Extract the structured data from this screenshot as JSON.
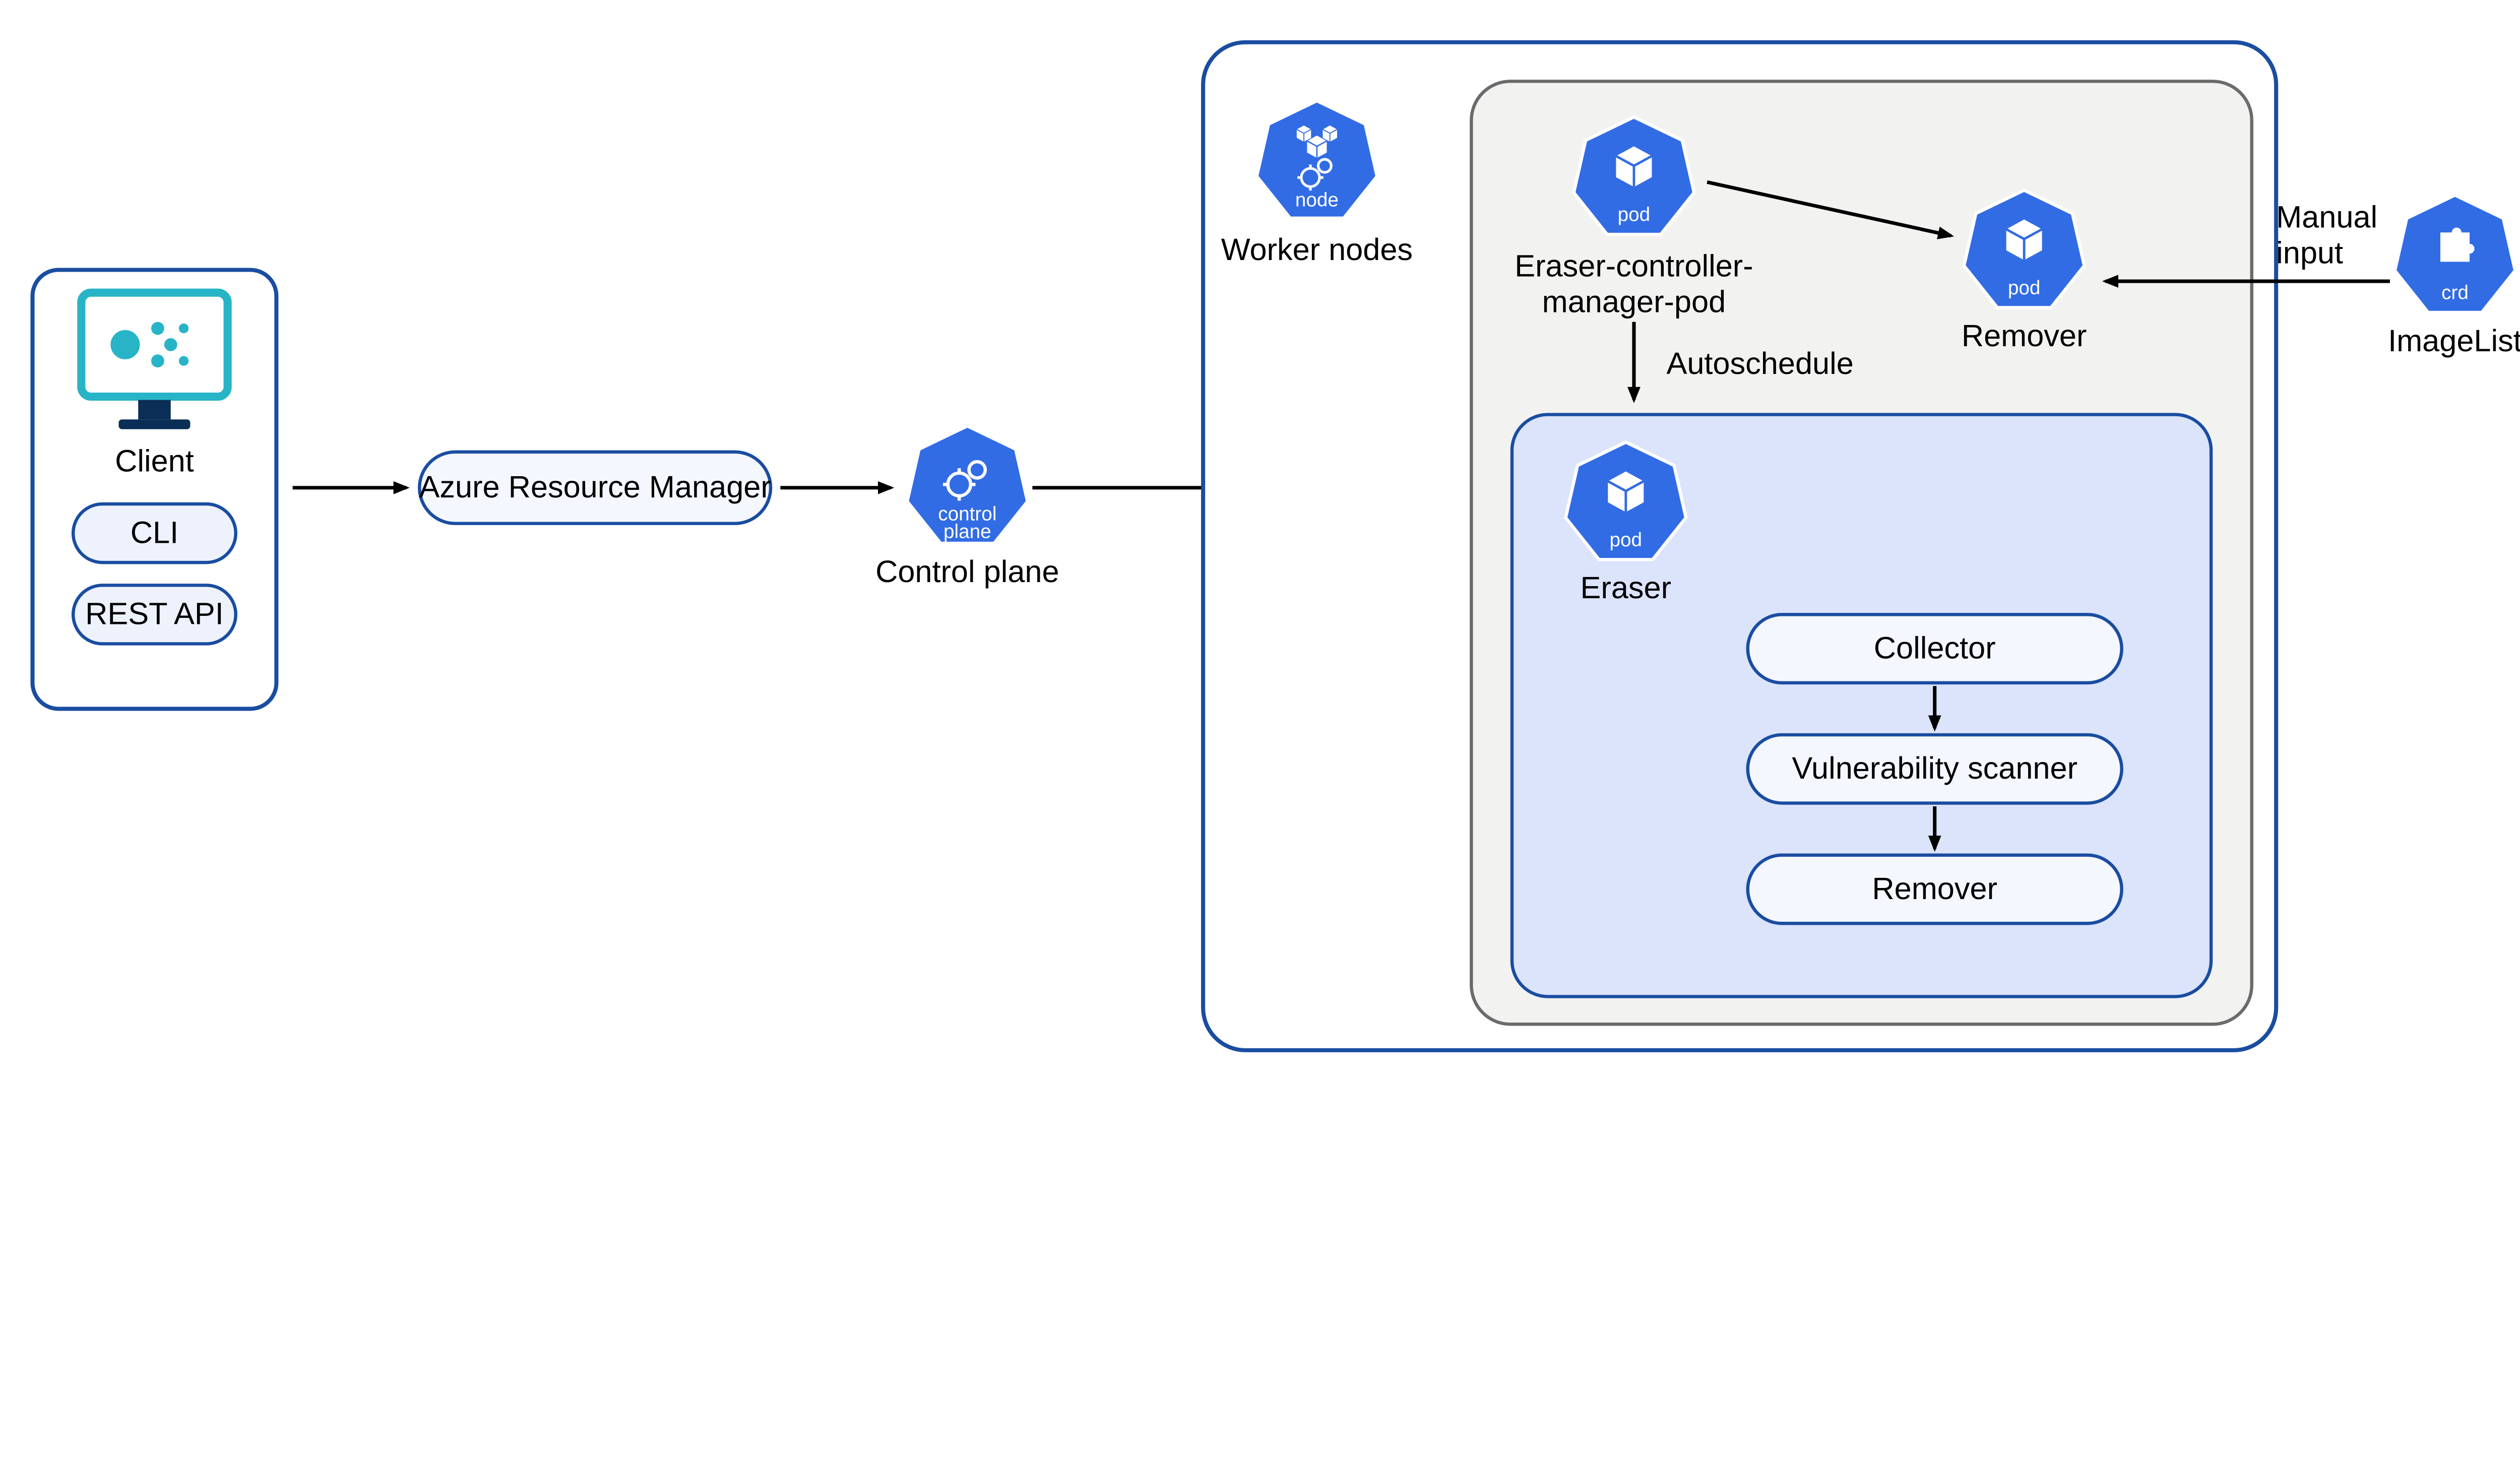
{
  "client": {
    "title": "Client",
    "cli_label": "CLI",
    "rest_label": "REST API"
  },
  "arm_label": "Azure Resource Manager",
  "control_plane": {
    "label": "Control plane",
    "icon_text": "control plane"
  },
  "worker": {
    "label": "Worker nodes",
    "icon_text": "node"
  },
  "pods": {
    "eraser_controller": {
      "label_line1": "Eraser-controller-",
      "label_line2": "manager-pod",
      "icon_text": "pod"
    },
    "remover": {
      "label": "Remover",
      "icon_text": "pod"
    },
    "eraser": {
      "label": "Eraser",
      "icon_text": "pod"
    }
  },
  "autoschedule_label": "Autoschedule",
  "manual_input": {
    "line1": "Manual",
    "line2": "input"
  },
  "imagelist": {
    "label": "ImageList",
    "icon_text": "crd"
  },
  "pipeline": {
    "collector": "Collector",
    "scanner": "Vulnerability scanner",
    "remover": "Remover"
  },
  "colors": {
    "azure_blue": "#326ce5",
    "border_blue": "#1a4da1",
    "fill_pale": "#eef2fc",
    "fill_inner": "#dbe4fb",
    "fill_grey": "#f2f2f1",
    "monitor_teal": "#27b4c7"
  }
}
